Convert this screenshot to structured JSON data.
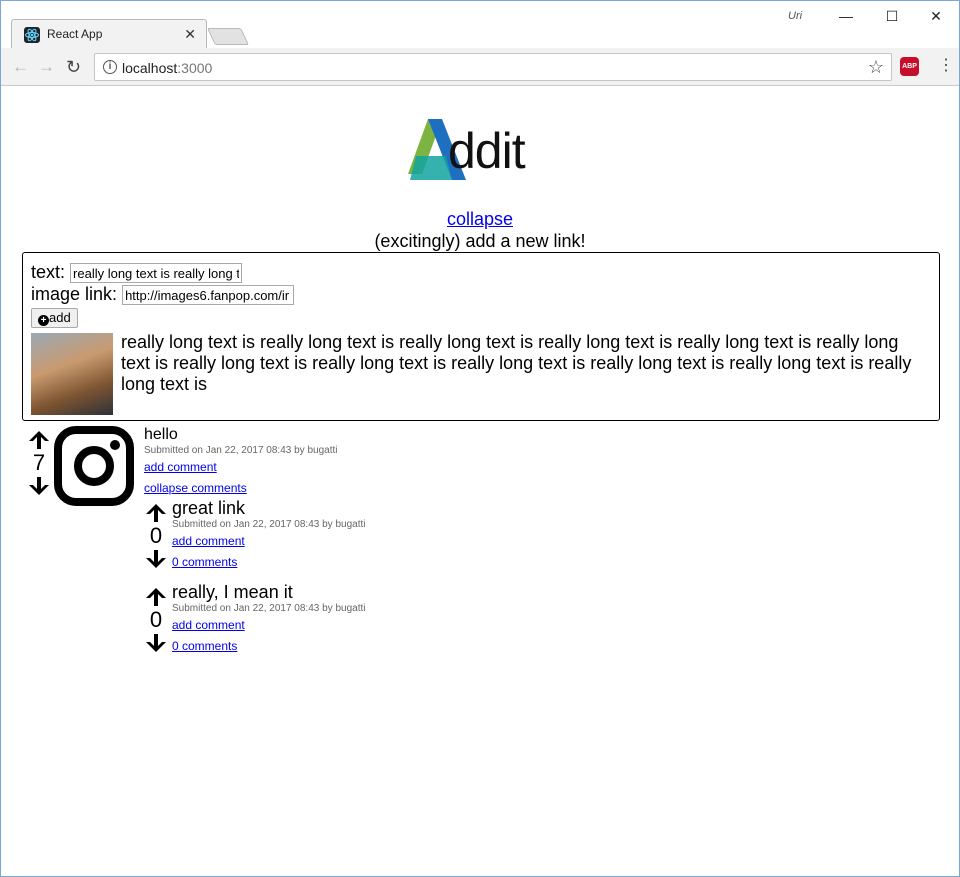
{
  "browser": {
    "tab_title": "React App",
    "user_label": "Uri",
    "url_host": "localhost",
    "url_port": ":3000"
  },
  "page": {
    "logo_text": "ddit",
    "collapse_link": "collapse",
    "subtitle": "(excitingly) add a new link!"
  },
  "form": {
    "text_label": "text:",
    "text_value": "really long text is really long t",
    "image_label": "image link:",
    "image_value": "http://images6.fanpop.com/ir",
    "add_label": "add",
    "preview_text": "really long text is really long text is really long text is really long text is really long text is really long text is really long text is really long text is really long text is really long text is really long text is really long text is"
  },
  "post": {
    "score": "7",
    "title": "hello",
    "meta": "Submitted on Jan 22, 2017 08:43 by bugatti",
    "add_comment": "add comment",
    "collapse_comments": "collapse comments"
  },
  "comments": [
    {
      "score": "0",
      "title": "great link",
      "meta": "Submitted on Jan 22, 2017 08:43 by bugatti",
      "add_comment": "add comment",
      "comments_link": "0 comments"
    },
    {
      "score": "0",
      "title": "really, I mean it",
      "meta": "Submitted on Jan 22, 2017 08:43 by bugatti",
      "add_comment": "add comment",
      "comments_link": "0 comments"
    }
  ]
}
